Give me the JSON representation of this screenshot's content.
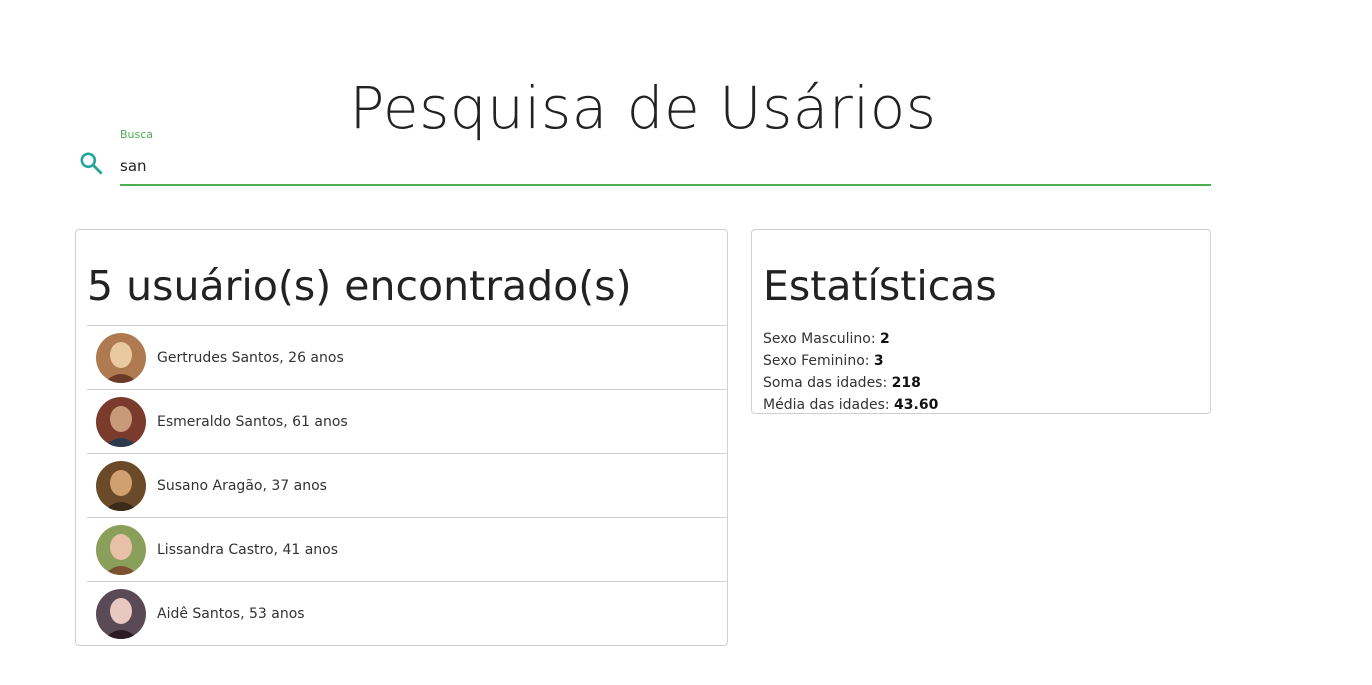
{
  "header": {
    "title": "Pesquisa de Usários"
  },
  "search": {
    "label": "Busca",
    "value": "san",
    "icon": "search-icon",
    "accent_color": "#4caf50",
    "icon_color": "#26a69a"
  },
  "results": {
    "heading": "5 usuário(s) encontrado(s)",
    "users": [
      {
        "label": "Gertrudes Santos, 26 anos",
        "avatar_colors": [
          "#b07a50",
          "#e8c9a0",
          "#6b3b2a"
        ]
      },
      {
        "label": "Esmeraldo Santos, 61 anos",
        "avatar_colors": [
          "#7a3a2c",
          "#c99a7a",
          "#2c3a4e"
        ]
      },
      {
        "label": "Susano Aragão, 37 anos",
        "avatar_colors": [
          "#6b4a2a",
          "#d0a070",
          "#3a2a1a"
        ]
      },
      {
        "label": "Lissandra Castro, 41 anos",
        "avatar_colors": [
          "#8aa05a",
          "#e8c0a8",
          "#7a5030"
        ]
      },
      {
        "label": "Aidê Santos, 53 anos",
        "avatar_colors": [
          "#5a4a55",
          "#e8c8c0",
          "#2a1a22"
        ]
      }
    ]
  },
  "stats": {
    "heading": "Estatísticas",
    "male_label": "Sexo Masculino: ",
    "male_value": "2",
    "female_label": "Sexo Feminino: ",
    "female_value": "3",
    "sum_label": "Soma das idades: ",
    "sum_value": "218",
    "avg_label": "Média das idades: ",
    "avg_value": "43.60"
  }
}
